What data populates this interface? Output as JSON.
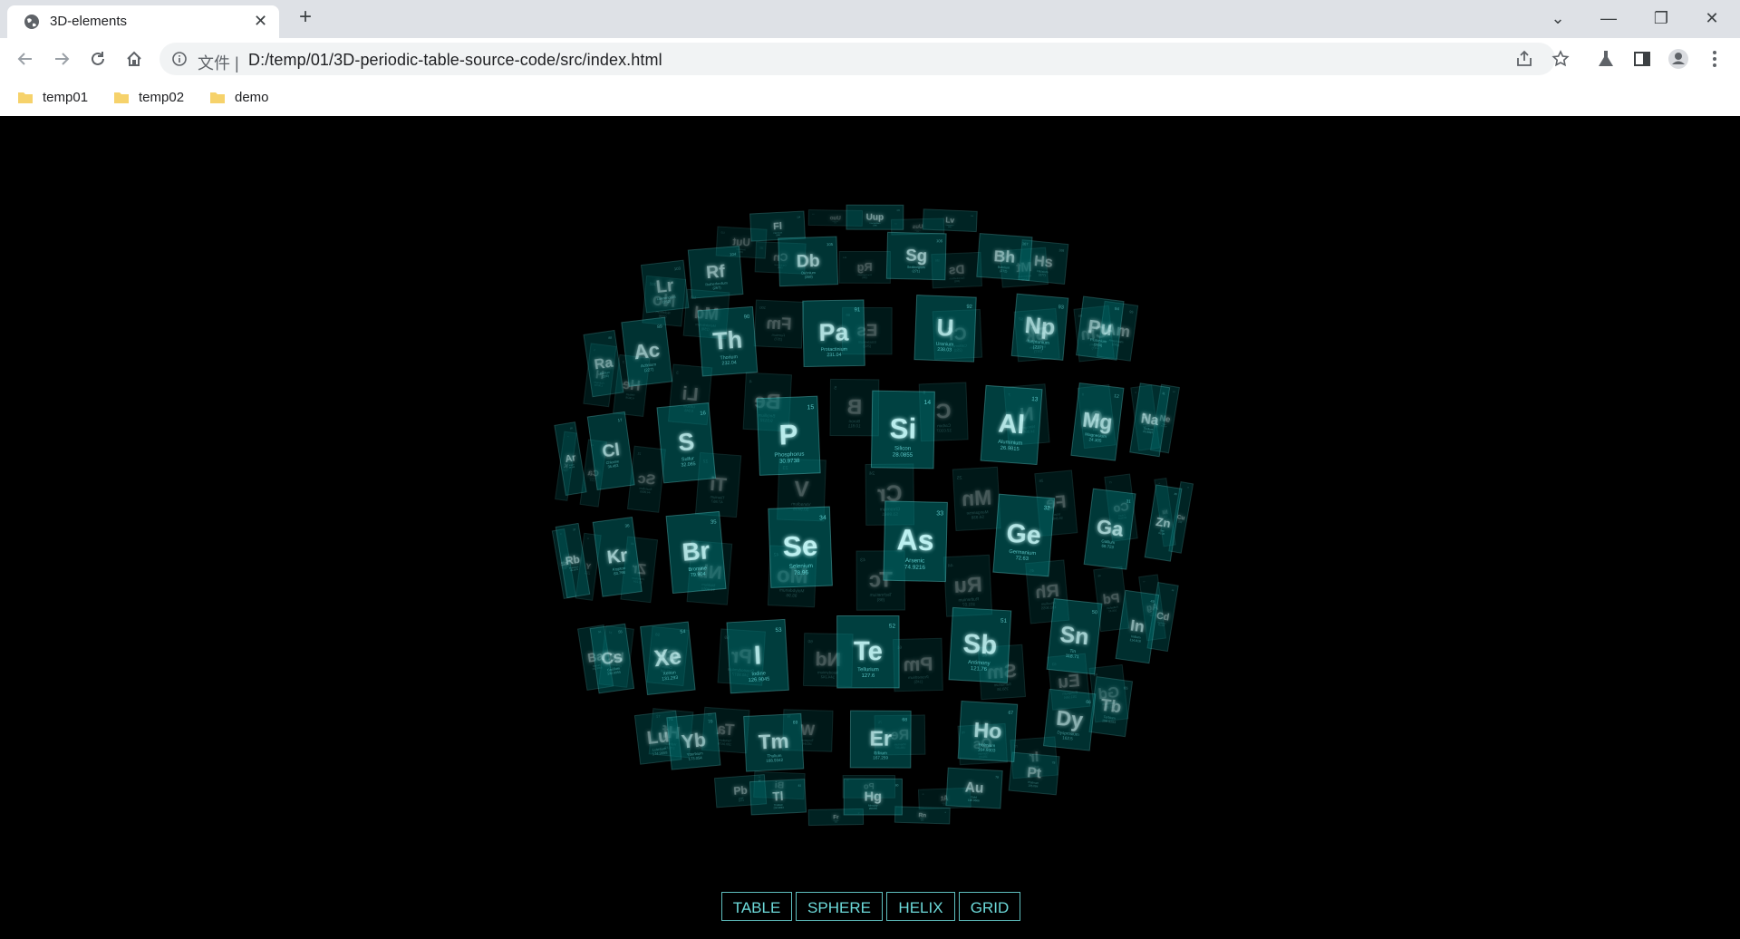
{
  "browser": {
    "tab_title": "3D-elements",
    "tab_close": "✕",
    "new_tab": "+",
    "scheme_label": "文件 |",
    "url": "D:/temp/01/3D-periodic-table-source-code/src/index.html",
    "bookmarks": [
      "temp01",
      "temp02",
      "demo"
    ],
    "window_controls": {
      "dropdown": "⌄",
      "minimize": "—",
      "restore": "❐",
      "close": "✕"
    }
  },
  "menu": {
    "table": "TABLE",
    "sphere": "SPHERE",
    "helix": "HELIX",
    "grid": "GRID"
  },
  "scene": {
    "mode": "sphere",
    "tile_color": "#008080",
    "glow_color": "#7fffff",
    "elements": [
      {
        "symbol": "Uuo",
        "name": "Ununoctium",
        "mass": "(294)",
        "number": "118"
      },
      {
        "symbol": "Uus",
        "name": "Ununseptium",
        "mass": "(294)",
        "number": "117"
      },
      {
        "symbol": "Lv",
        "name": "Livermorium",
        "mass": "(293)",
        "number": "116"
      },
      {
        "symbol": "Uup",
        "name": "Ununpentium",
        "mass": "(288)",
        "number": "115"
      },
      {
        "symbol": "Fl",
        "name": "Flerovium",
        "mass": "(289)",
        "number": "114"
      },
      {
        "symbol": "Uut",
        "name": "Ununtrium",
        "mass": "(284)",
        "number": "113"
      },
      {
        "symbol": "Cn",
        "name": "Copernicium",
        "mass": "(285)",
        "number": "112"
      },
      {
        "symbol": "Rg",
        "name": "Roentgenium",
        "mass": "(280)",
        "number": "111"
      },
      {
        "symbol": "Ds",
        "name": "Darmstadtium",
        "mass": "(281)",
        "number": "110"
      },
      {
        "symbol": "Mt",
        "name": "Meitnerium",
        "mass": "(276)",
        "number": "109"
      },
      {
        "symbol": "Hs",
        "name": "Hassium",
        "mass": "(277)",
        "number": "108"
      },
      {
        "symbol": "Bh",
        "name": "Bohrium",
        "mass": "(272)",
        "number": "107"
      },
      {
        "symbol": "Sg",
        "name": "Seaborgium",
        "mass": "(271)",
        "number": "106"
      },
      {
        "symbol": "Db",
        "name": "Dubnium",
        "mass": "(268)",
        "number": "105"
      },
      {
        "symbol": "Rf",
        "name": "Rutherfordium",
        "mass": "(267)",
        "number": "104"
      },
      {
        "symbol": "Lr",
        "name": "Lawrencium",
        "mass": "(262)",
        "number": "103"
      },
      {
        "symbol": "No",
        "name": "Nobelium",
        "mass": "(259)",
        "number": "102"
      },
      {
        "symbol": "Md",
        "name": "Mendelevium",
        "mass": "(258)",
        "number": "101"
      },
      {
        "symbol": "Fm",
        "name": "Fermium",
        "mass": "(257)",
        "number": "100"
      },
      {
        "symbol": "Es",
        "name": "Einsteinium",
        "mass": "(252)",
        "number": "99"
      },
      {
        "symbol": "Cf",
        "name": "Californium",
        "mass": "(251)",
        "number": "98"
      },
      {
        "symbol": "Bk",
        "name": "Berkelium",
        "mass": "(247)",
        "number": "97"
      },
      {
        "symbol": "Cm",
        "name": "Curium",
        "mass": "(247)",
        "number": "96"
      },
      {
        "symbol": "Am",
        "name": "Americium",
        "mass": "(243)",
        "number": "95"
      },
      {
        "symbol": "Pu",
        "name": "Plutonium",
        "mass": "(244)",
        "number": "94"
      },
      {
        "symbol": "Np",
        "name": "Neptunium",
        "mass": "(237)",
        "number": "93"
      },
      {
        "symbol": "U",
        "name": "Uranium",
        "mass": "238.03",
        "number": "92"
      },
      {
        "symbol": "Pa",
        "name": "Protactinium",
        "mass": "231.04",
        "number": "91"
      },
      {
        "symbol": "Th",
        "name": "Thorium",
        "mass": "232.04",
        "number": "90"
      },
      {
        "symbol": "Ac",
        "name": "Actinium",
        "mass": "(227)",
        "number": "89"
      },
      {
        "symbol": "Ra",
        "name": "Radium",
        "mass": "(226)",
        "number": "88"
      },
      {
        "symbol": "H",
        "name": "Hydrogen",
        "mass": "1.00794",
        "number": "1"
      },
      {
        "symbol": "He",
        "name": "Helium",
        "mass": "4.0026",
        "number": "2"
      },
      {
        "symbol": "Li",
        "name": "Lithium",
        "mass": "6.941",
        "number": "3"
      },
      {
        "symbol": "Be",
        "name": "Beryllium",
        "mass": "9.0122",
        "number": "4"
      },
      {
        "symbol": "B",
        "name": "Boron",
        "mass": "10.811",
        "number": "5"
      },
      {
        "symbol": "C",
        "name": "Carbon",
        "mass": "12.0107",
        "number": "6"
      },
      {
        "symbol": "N",
        "name": "Nitrogen",
        "mass": "14.0067",
        "number": "7"
      },
      {
        "symbol": "O",
        "name": "Oxygen",
        "mass": "15.9994",
        "number": "8"
      },
      {
        "symbol": "F",
        "name": "Fluorine",
        "mass": "18.9984",
        "number": "9"
      },
      {
        "symbol": "Ne",
        "name": "Neon",
        "mass": "20.1797",
        "number": "10"
      },
      {
        "symbol": "Na",
        "name": "Sodium",
        "mass": "22.9897",
        "number": "11"
      },
      {
        "symbol": "Mg",
        "name": "Magnesium",
        "mass": "24.305",
        "number": "12"
      },
      {
        "symbol": "Al",
        "name": "Aluminium",
        "mass": "26.9815",
        "number": "13"
      },
      {
        "symbol": "Si",
        "name": "Silicon",
        "mass": "28.0855",
        "number": "14"
      },
      {
        "symbol": "P",
        "name": "Phosphorus",
        "mass": "30.9738",
        "number": "15"
      },
      {
        "symbol": "S",
        "name": "Sulfur",
        "mass": "32.065",
        "number": "16"
      },
      {
        "symbol": "Cl",
        "name": "Chlorine",
        "mass": "35.453",
        "number": "17"
      },
      {
        "symbol": "Ar",
        "name": "Argon",
        "mass": "39.948",
        "number": "18"
      },
      {
        "symbol": "K",
        "name": "Potassium",
        "mass": "39.948",
        "number": "19"
      },
      {
        "symbol": "Ca",
        "name": "Calcium",
        "mass": "40.078",
        "number": "20"
      },
      {
        "symbol": "Sc",
        "name": "Scandium",
        "mass": "44.9559",
        "number": "21"
      },
      {
        "symbol": "Ti",
        "name": "Titanium",
        "mass": "47.867",
        "number": "22"
      },
      {
        "symbol": "V",
        "name": "Vanadium",
        "mass": "50.9415",
        "number": "23"
      },
      {
        "symbol": "Cr",
        "name": "Chromium",
        "mass": "51.9961",
        "number": "24"
      },
      {
        "symbol": "Mn",
        "name": "Manganese",
        "mass": "54.938",
        "number": "25"
      },
      {
        "symbol": "Fe",
        "name": "Iron",
        "mass": "55.845",
        "number": "26"
      },
      {
        "symbol": "Co",
        "name": "Cobalt",
        "mass": "58.9332",
        "number": "27"
      },
      {
        "symbol": "Ni",
        "name": "Nickel",
        "mass": "58.6934",
        "number": "28"
      },
      {
        "symbol": "Cu",
        "name": "Copper",
        "mass": "63.546",
        "number": "29"
      },
      {
        "symbol": "Zn",
        "name": "Zinc",
        "mass": "65.38",
        "number": "30"
      },
      {
        "symbol": "Ga",
        "name": "Gallium",
        "mass": "69.723",
        "number": "31"
      },
      {
        "symbol": "Ge",
        "name": "Germanium",
        "mass": "72.63",
        "number": "32"
      },
      {
        "symbol": "As",
        "name": "Arsenic",
        "mass": "74.9216",
        "number": "33"
      },
      {
        "symbol": "Se",
        "name": "Selenium",
        "mass": "78.96",
        "number": "34"
      },
      {
        "symbol": "Br",
        "name": "Bromine",
        "mass": "79.904",
        "number": "35"
      },
      {
        "symbol": "Kr",
        "name": "Krypton",
        "mass": "83.798",
        "number": "36"
      },
      {
        "symbol": "Rb",
        "name": "Rubidium",
        "mass": "85.4678",
        "number": "37"
      },
      {
        "symbol": "Sr",
        "name": "Strontium",
        "mass": "87.62",
        "number": "38"
      },
      {
        "symbol": "Y",
        "name": "Yttrium",
        "mass": "88.9059",
        "number": "39"
      },
      {
        "symbol": "Zr",
        "name": "Zirconium",
        "mass": "91.224",
        "number": "40"
      },
      {
        "symbol": "Nb",
        "name": "Niobium",
        "mass": "92.9064",
        "number": "41"
      },
      {
        "symbol": "Mo",
        "name": "Molybdenum",
        "mass": "95.96",
        "number": "42"
      },
      {
        "symbol": "Tc",
        "name": "Technetium",
        "mass": "(98)",
        "number": "43"
      },
      {
        "symbol": "Ru",
        "name": "Ruthenium",
        "mass": "101.07",
        "number": "44"
      },
      {
        "symbol": "Rh",
        "name": "Rhodium",
        "mass": "102.9055",
        "number": "45"
      },
      {
        "symbol": "Pd",
        "name": "Palladium",
        "mass": "106.42",
        "number": "46"
      },
      {
        "symbol": "Ag",
        "name": "Silver",
        "mass": "107.8682",
        "number": "47"
      },
      {
        "symbol": "Cd",
        "name": "Cadmium",
        "mass": "112.411",
        "number": "48"
      },
      {
        "symbol": "In",
        "name": "Indium",
        "mass": "114.818",
        "number": "49"
      },
      {
        "symbol": "Sn",
        "name": "Tin",
        "mass": "118.71",
        "number": "50"
      },
      {
        "symbol": "Sb",
        "name": "Antimony",
        "mass": "121.76",
        "number": "51"
      },
      {
        "symbol": "Te",
        "name": "Tellurium",
        "mass": "127.6",
        "number": "52"
      },
      {
        "symbol": "I",
        "name": "Iodine",
        "mass": "126.9045",
        "number": "53"
      },
      {
        "symbol": "Xe",
        "name": "Xenon",
        "mass": "131.293",
        "number": "54"
      },
      {
        "symbol": "Cs",
        "name": "Caesium",
        "mass": "132.9055",
        "number": "55"
      },
      {
        "symbol": "Ba",
        "name": "Barium",
        "mass": "132.9055",
        "number": "56"
      },
      {
        "symbol": "La",
        "name": "Lanthanum",
        "mass": "138.9055",
        "number": "57"
      },
      {
        "symbol": "Ce",
        "name": "Cerium",
        "mass": "140.116",
        "number": "58"
      },
      {
        "symbol": "Pr",
        "name": "Praseodymium",
        "mass": "140.9077",
        "number": "59"
      },
      {
        "symbol": "Nd",
        "name": "Neodymium",
        "mass": "144.242",
        "number": "60"
      },
      {
        "symbol": "Pm",
        "name": "Promethium",
        "mass": "(145)",
        "number": "61"
      },
      {
        "symbol": "Sm",
        "name": "Samarium",
        "mass": "150.36",
        "number": "62"
      },
      {
        "symbol": "Eu",
        "name": "Europium",
        "mass": "151.964",
        "number": "63"
      },
      {
        "symbol": "Gd",
        "name": "Gadolinium",
        "mass": "157.25",
        "number": "64"
      },
      {
        "symbol": "Tb",
        "name": "Terbium",
        "mass": "158.9253",
        "number": "65"
      },
      {
        "symbol": "Dy",
        "name": "Dysprosium",
        "mass": "162.5",
        "number": "66"
      },
      {
        "symbol": "Ho",
        "name": "Holmium",
        "mass": "164.9303",
        "number": "67"
      },
      {
        "symbol": "Er",
        "name": "Erbium",
        "mass": "167.259",
        "number": "68"
      },
      {
        "symbol": "Tm",
        "name": "Thulium",
        "mass": "168.9342",
        "number": "69"
      },
      {
        "symbol": "Yb",
        "name": "Ytterbium",
        "mass": "173.054",
        "number": "70"
      },
      {
        "symbol": "Lu",
        "name": "Lutetium",
        "mass": "174.9668",
        "number": "71"
      },
      {
        "symbol": "Hf",
        "name": "Hafnium",
        "mass": "178.49",
        "number": "72"
      },
      {
        "symbol": "Ta",
        "name": "Tantalum",
        "mass": "180.9479",
        "number": "73"
      },
      {
        "symbol": "W",
        "name": "Tungsten",
        "mass": "183.84",
        "number": "74"
      },
      {
        "symbol": "Re",
        "name": "Rhenium",
        "mass": "186.207",
        "number": "75"
      },
      {
        "symbol": "Os",
        "name": "Osmium",
        "mass": "190.23",
        "number": "76"
      },
      {
        "symbol": "Ir",
        "name": "Iridium",
        "mass": "192.217",
        "number": "77"
      },
      {
        "symbol": "Pt",
        "name": "Platinum",
        "mass": "195.084",
        "number": "78"
      },
      {
        "symbol": "Au",
        "name": "Gold",
        "mass": "196.9666",
        "number": "79"
      },
      {
        "symbol": "Hg",
        "name": "Mercury",
        "mass": "200.59",
        "number": "80"
      },
      {
        "symbol": "Tl",
        "name": "Thallium",
        "mass": "204.3833",
        "number": "81"
      },
      {
        "symbol": "Pb",
        "name": "Lead",
        "mass": "207.2",
        "number": "82"
      },
      {
        "symbol": "Bi",
        "name": "Bismuth",
        "mass": "208.9804",
        "number": "83"
      },
      {
        "symbol": "Po",
        "name": "Polonium",
        "mass": "(209)",
        "number": "84"
      },
      {
        "symbol": "At",
        "name": "Astatine",
        "mass": "(210)",
        "number": "85"
      },
      {
        "symbol": "Rn",
        "name": "Radon",
        "mass": "(222)",
        "number": "86"
      },
      {
        "symbol": "Fr",
        "name": "Francium",
        "mass": "(223)",
        "number": "87"
      }
    ]
  }
}
